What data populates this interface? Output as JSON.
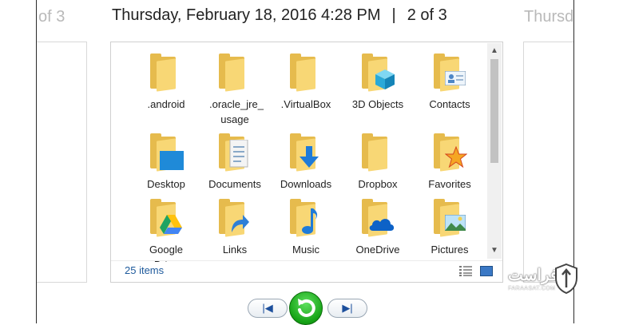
{
  "header": {
    "title": "Thursday, February 18, 2016 4:28 PM",
    "separator": "|",
    "position": "2 of 3"
  },
  "ghosts": {
    "left_text": "of 3",
    "right_text": "Thursd"
  },
  "explorer": {
    "items": [
      {
        "label": ".android",
        "icon": "folder-icon"
      },
      {
        "label": ".oracle_jre_ usage",
        "icon": "folder-icon"
      },
      {
        "label": ".VirtualBox",
        "icon": "folder-icon"
      },
      {
        "label": "3D Objects",
        "icon": "3d-objects-folder-icon"
      },
      {
        "label": "Contacts",
        "icon": "contacts-folder-icon"
      },
      {
        "label": "Desktop",
        "icon": "desktop-folder-icon"
      },
      {
        "label": "Documents",
        "icon": "documents-folder-icon"
      },
      {
        "label": "Downloads",
        "icon": "downloads-folder-icon"
      },
      {
        "label": "Dropbox",
        "icon": "folder-icon"
      },
      {
        "label": "Favorites",
        "icon": "favorites-folder-icon"
      },
      {
        "label": "Google Drive",
        "icon": "google-drive-folder-icon"
      },
      {
        "label": "Links",
        "icon": "links-folder-icon"
      },
      {
        "label": "Music",
        "icon": "music-folder-icon"
      },
      {
        "label": "OneDrive",
        "icon": "onedrive-folder-icon"
      },
      {
        "label": "Pictures",
        "icon": "pictures-folder-icon"
      }
    ],
    "status": {
      "count": "25 items"
    }
  },
  "nav": {
    "prev_label": "|◀",
    "next_label": "▶|"
  },
  "watermark": {
    "name": "فراست",
    "url": "FARAASAT.COM"
  },
  "colors": {
    "folder_back": "#e6bb4d",
    "folder_front": "#f8d775",
    "accent_blue": "#1e5a9c",
    "play_green": "#16a316"
  }
}
